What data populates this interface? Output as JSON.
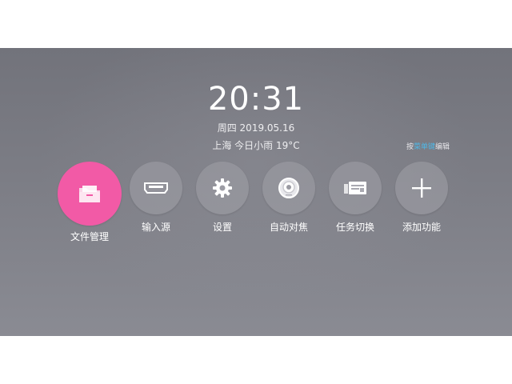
{
  "clock": {
    "time": "20:31"
  },
  "date": {
    "text": "周四 2019.05.16"
  },
  "weather": {
    "text": "上海 今日小雨 19°C"
  },
  "hint": {
    "prefix": "按",
    "accent": "菜单键",
    "suffix": "编辑"
  },
  "apps": [
    {
      "label": "文件管理",
      "icon": "folder-icon",
      "active": true
    },
    {
      "label": "输入源",
      "icon": "hdmi-port-icon"
    },
    {
      "label": "设置",
      "icon": "gear-icon"
    },
    {
      "label": "自动对焦",
      "icon": "lens-icon"
    },
    {
      "label": "任务切换",
      "icon": "task-cards-icon"
    },
    {
      "label": "添加功能",
      "icon": "plus-icon"
    }
  ],
  "colors": {
    "active_app": "#f25aa6",
    "hint_accent": "#4fb7e6"
  }
}
